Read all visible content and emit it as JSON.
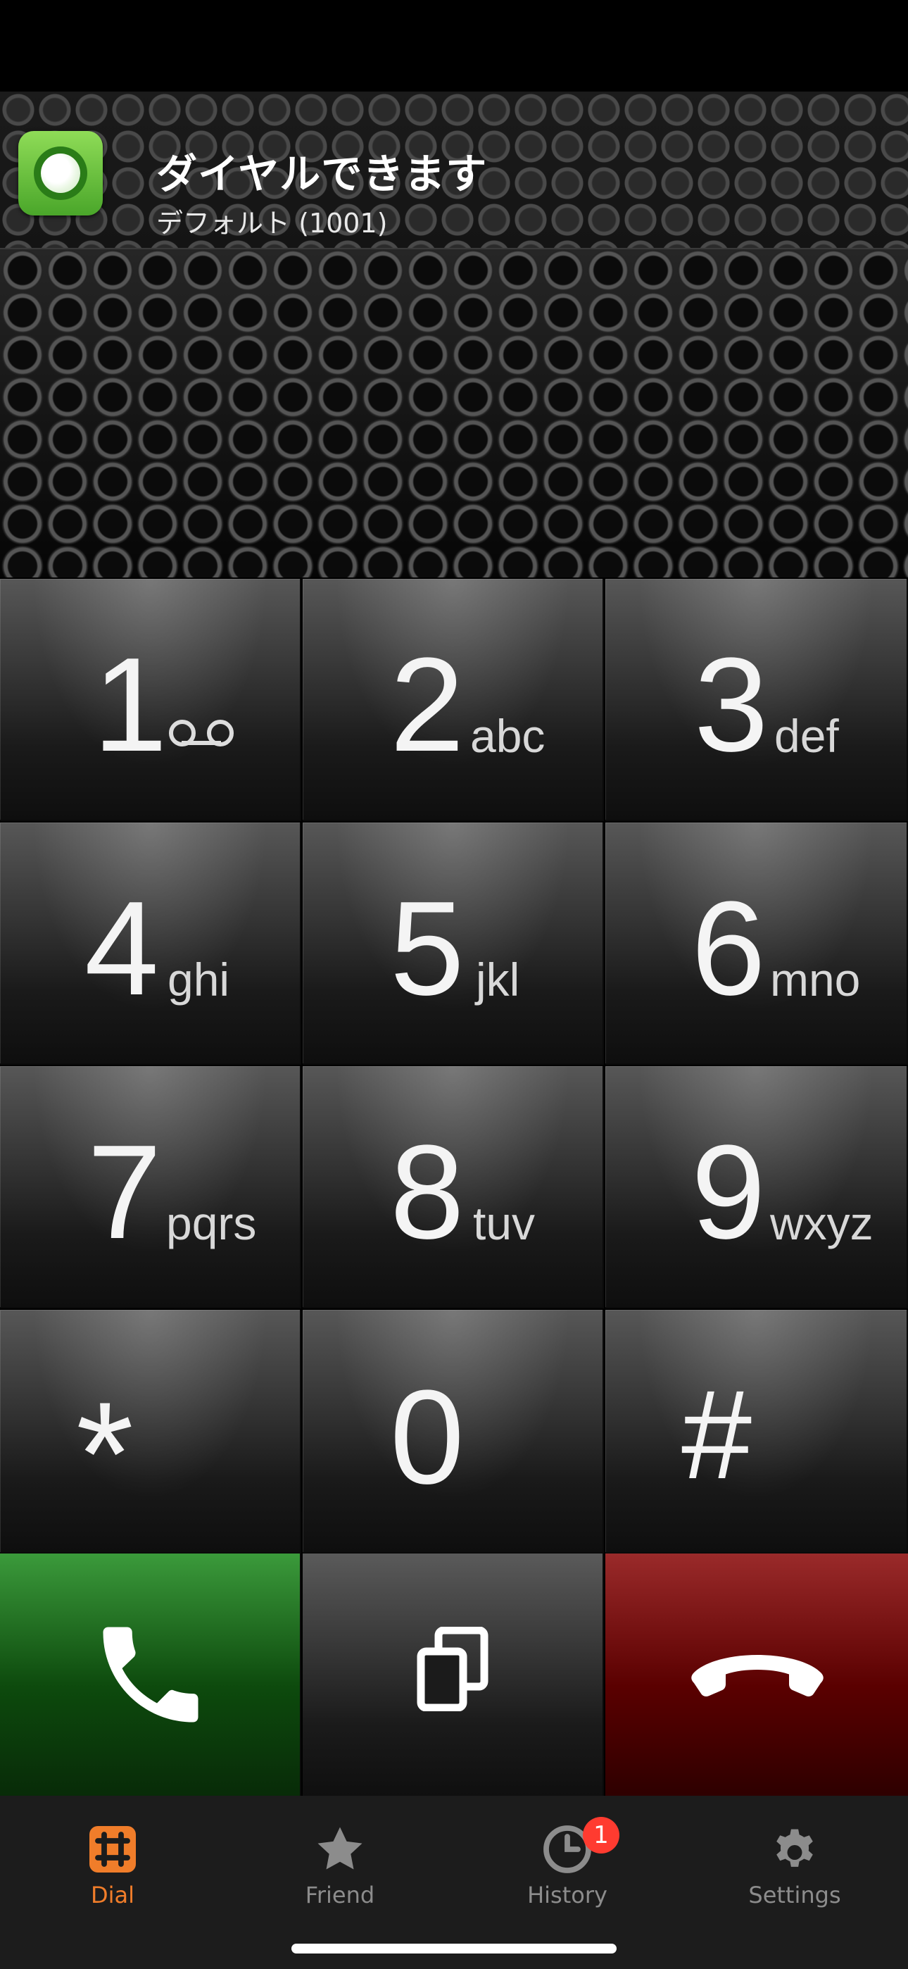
{
  "status": {
    "title": "ダイヤルできます",
    "subtitle": "デフォルト (1001)",
    "icon": "online-status-icon"
  },
  "keypad": {
    "keys": [
      {
        "digit": "1",
        "letters": "",
        "icon": "voicemail-icon"
      },
      {
        "digit": "2",
        "letters": "abc"
      },
      {
        "digit": "3",
        "letters": "def"
      },
      {
        "digit": "4",
        "letters": "ghi"
      },
      {
        "digit": "5",
        "letters": "jkl"
      },
      {
        "digit": "6",
        "letters": "mno"
      },
      {
        "digit": "7",
        "letters": "pqrs"
      },
      {
        "digit": "8",
        "letters": "tuv"
      },
      {
        "digit": "9",
        "letters": "wxyz"
      },
      {
        "digit": "*",
        "letters": ""
      },
      {
        "digit": "0",
        "letters": ""
      },
      {
        "digit": "#",
        "letters": ""
      }
    ]
  },
  "actions": {
    "call": "call-icon",
    "copy": "copy-icon",
    "hangup": "hangup-icon"
  },
  "tabbar": {
    "tabs": [
      {
        "label": "Dial",
        "icon": "dialpad-icon",
        "active": true
      },
      {
        "label": "Friend",
        "icon": "star-icon",
        "active": false
      },
      {
        "label": "History",
        "icon": "clock-icon",
        "active": false,
        "badge": "1"
      },
      {
        "label": "Settings",
        "icon": "gear-icon",
        "active": false
      }
    ]
  },
  "colors": {
    "active_tab": "#f07d2a",
    "inactive_tab": "#8c8c8c",
    "badge": "#ff3b30",
    "call_button": "#0d4a0d",
    "hangup_button": "#5a0000"
  }
}
